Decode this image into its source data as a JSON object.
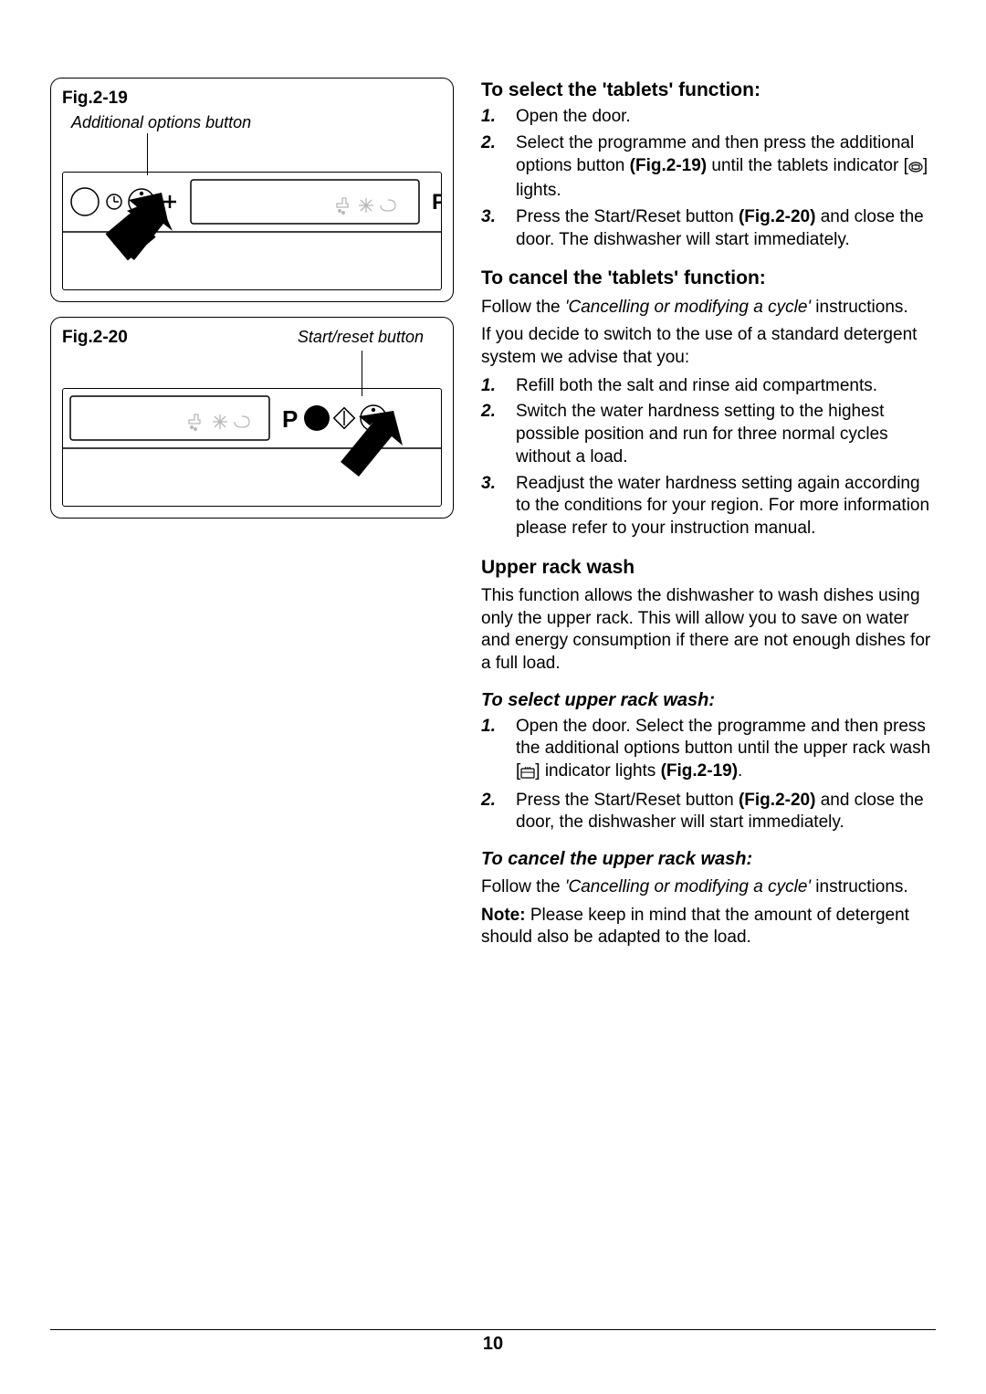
{
  "page_number": "10",
  "figures": {
    "f19": {
      "label": "Fig.2-19",
      "caption": "Additional options button"
    },
    "f20": {
      "label": "Fig.2-20",
      "caption": "Start/reset button"
    }
  },
  "right": {
    "h_select_tablets": "To select the 'tablets' function:",
    "select_tablets_steps": {
      "s1": "Open the door.",
      "s2_a": "Select the programme and then press the additional options button ",
      "s2_b": "(Fig.2-19)",
      "s2_c": " until the tablets indicator [",
      "s2_d": "] lights.",
      "s3_a": "Press the Start/Reset button ",
      "s3_b": "(Fig.2-20)",
      "s3_c": " and close the door. The dishwasher will start immediately."
    },
    "h_cancel_tablets": "To cancel the 'tablets' function:",
    "cancel_tablets_p_a": "Follow the ",
    "cancel_tablets_p_b": "'Cancelling or modifying a cycle'",
    "cancel_tablets_p_c": " instructions.",
    "switch_p": "If you decide to switch to the use of a standard detergent system we advise that you:",
    "switch_steps": {
      "s1": "Refill both the salt and rinse aid compartments.",
      "s2": "Switch the water hardness setting to the highest possible position and run for three normal cycles without a load.",
      "s3": "Readjust the water hardness setting again according to the conditions for your region. For more information please refer to your instruction manual."
    },
    "h_upper": "Upper rack wash",
    "upper_p": "This function allows the dishwasher to wash dishes using only the upper rack. This will allow you to save on water and energy consumption if there are not enough dishes for a full load.",
    "h_upper_select": "To select upper rack wash:",
    "upper_select_steps": {
      "s1_a": "Open the door. Select the programme and then press the additional options button until the upper rack wash [",
      "s1_b": "] indicator lights ",
      "s1_c": "(Fig.2-19)",
      "s1_d": ".",
      "s2_a": "Press the Start/Reset button ",
      "s2_b": "(Fig.2-20)",
      "s2_c": " and close the door, the dishwasher will start immediately."
    },
    "h_upper_cancel": "To cancel the upper rack wash:",
    "upper_cancel_p_a": "Follow the ",
    "upper_cancel_p_b": "'Cancelling or modifying a cycle'",
    "upper_cancel_p_c": " instructions.",
    "note_label": "Note:",
    "note_text": " Please keep in mind that the amount of detergent should also be adapted to the load."
  }
}
